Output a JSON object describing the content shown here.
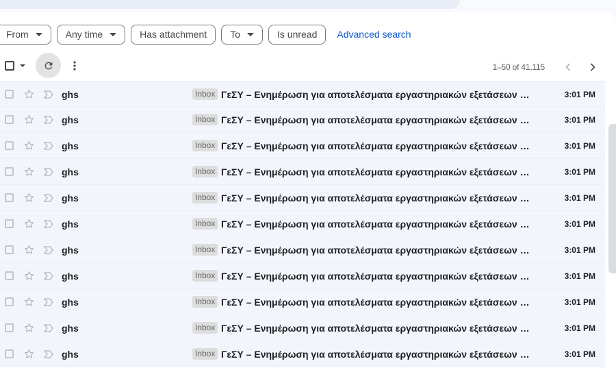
{
  "filters": {
    "from": "From",
    "any_time": "Any time",
    "has_attachment": "Has attachment",
    "to": "To",
    "is_unread": "Is unread",
    "advanced_search": "Advanced search"
  },
  "toolbar": {
    "pagination": "1–50 of 41,115"
  },
  "icons": {
    "select_all": "checkbox-icon",
    "refresh": "refresh-icon",
    "more": "more-vert-icon",
    "prev": "chevron-left-icon",
    "next": "chevron-right-icon",
    "star": "star-outline-icon",
    "important": "important-outline-icon"
  },
  "colors": {
    "accent": "#0b57d0",
    "row_bg": "#f2f6fc",
    "label_bg": "#dddddd"
  },
  "emails": [
    {
      "sender": "ghs",
      "label": "Inbox",
      "subject": "ΓεΣΥ – Ενημέρωση για αποτελέσματα εργαστηριακών εξετάσεων Ι...",
      "time": "3:01 PM"
    },
    {
      "sender": "ghs",
      "label": "Inbox",
      "subject": "ΓεΣΥ – Ενημέρωση για αποτελέσματα εργαστηριακών εξετάσεων Ι...",
      "time": "3:01 PM"
    },
    {
      "sender": "ghs",
      "label": "Inbox",
      "subject": "ΓεΣΥ – Ενημέρωση για αποτελέσματα εργαστηριακών εξετάσεων Ι...",
      "time": "3:01 PM"
    },
    {
      "sender": "ghs",
      "label": "Inbox",
      "subject": "ΓεΣΥ – Ενημέρωση για αποτελέσματα εργαστηριακών εξετάσεων Ι...",
      "time": "3:01 PM"
    },
    {
      "sender": "ghs",
      "label": "Inbox",
      "subject": "ΓεΣΥ – Ενημέρωση για αποτελέσματα εργαστηριακών εξετάσεων Ι...",
      "time": "3:01 PM"
    },
    {
      "sender": "ghs",
      "label": "Inbox",
      "subject": "ΓεΣΥ – Ενημέρωση για αποτελέσματα εργαστηριακών εξετάσεων Ι...",
      "time": "3:01 PM"
    },
    {
      "sender": "ghs",
      "label": "Inbox",
      "subject": "ΓεΣΥ – Ενημέρωση για αποτελέσματα εργαστηριακών εξετάσεων Ι...",
      "time": "3:01 PM"
    },
    {
      "sender": "ghs",
      "label": "Inbox",
      "subject": "ΓεΣΥ – Ενημέρωση για αποτελέσματα εργαστηριακών εξετάσεων Ι...",
      "time": "3:01 PM"
    },
    {
      "sender": "ghs",
      "label": "Inbox",
      "subject": "ΓεΣΥ – Ενημέρωση για αποτελέσματα εργαστηριακών εξετάσεων Ι...",
      "time": "3:01 PM"
    },
    {
      "sender": "ghs",
      "label": "Inbox",
      "subject": "ΓεΣΥ – Ενημέρωση για αποτελέσματα εργαστηριακών εξετάσεων Ι...",
      "time": "3:01 PM"
    },
    {
      "sender": "ghs",
      "label": "Inbox",
      "subject": "ΓεΣΥ – Ενημέρωση για αποτελέσματα εργαστηριακών εξετάσεων Ι...",
      "time": "3:01 PM"
    }
  ]
}
